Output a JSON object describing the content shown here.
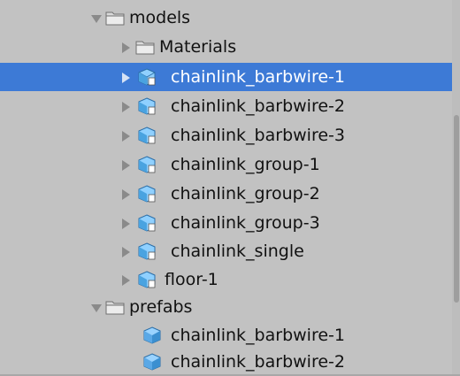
{
  "tree": {
    "items": [
      {
        "label": "models",
        "icon": "folder-icon",
        "expanded": true,
        "selected": false
      },
      {
        "label": "Materials",
        "icon": "folder-icon",
        "expanded": false,
        "selected": false
      },
      {
        "label": "chainlink_barbwire-1",
        "icon": "model-icon",
        "expanded": false,
        "selected": true
      },
      {
        "label": "chainlink_barbwire-2",
        "icon": "model-icon",
        "expanded": false,
        "selected": false
      },
      {
        "label": "chainlink_barbwire-3",
        "icon": "model-icon",
        "expanded": false,
        "selected": false
      },
      {
        "label": "chainlink_group-1",
        "icon": "model-icon",
        "expanded": false,
        "selected": false
      },
      {
        "label": "chainlink_group-2",
        "icon": "model-icon",
        "expanded": false,
        "selected": false
      },
      {
        "label": "chainlink_group-3",
        "icon": "model-icon",
        "expanded": false,
        "selected": false
      },
      {
        "label": "chainlink_single",
        "icon": "model-icon",
        "expanded": false,
        "selected": false
      },
      {
        "label": "floor-1",
        "icon": "model-icon",
        "expanded": false,
        "selected": false
      },
      {
        "label": "prefabs",
        "icon": "folder-icon",
        "expanded": true,
        "selected": false
      },
      {
        "label": "chainlink_barbwire-1",
        "icon": "prefab-icon",
        "selected": false
      },
      {
        "label": "chainlink_barbwire-2",
        "icon": "prefab-icon",
        "selected": false
      }
    ]
  },
  "colors": {
    "background": "#c2c2c2",
    "selection": "#3d7ad6",
    "model_icon": "#4aa3e0",
    "prefab_icon": "#5aa8e6"
  }
}
